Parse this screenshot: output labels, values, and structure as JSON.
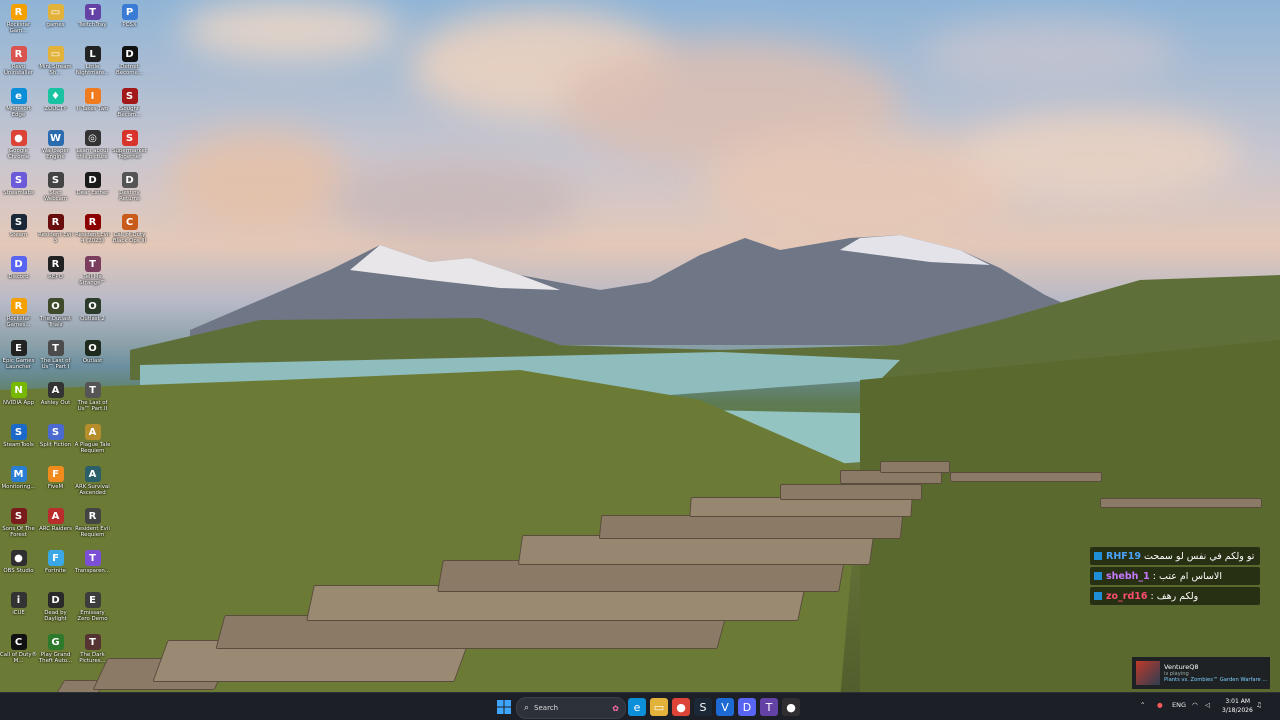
{
  "desktop_icons": [
    {
      "label": "Rockstar Gam...",
      "color": "#f4a000",
      "glyph": "R"
    },
    {
      "label": "games",
      "color": "#e2b23b",
      "glyph": "▭"
    },
    {
      "label": "TwitchTray",
      "color": "#6441a5",
      "glyph": "T"
    },
    {
      "label": "PCSX",
      "color": "#3a7bd5",
      "glyph": "P"
    },
    {
      "label": "Revo Uninstaller",
      "color": "#d9534f",
      "glyph": "R"
    },
    {
      "label": "Mini Stream Sh...",
      "color": "#e2b23b",
      "glyph": "▭"
    },
    {
      "label": "Little Nightmare...",
      "color": "#222",
      "glyph": "L"
    },
    {
      "label": "Detroit Become...",
      "color": "#111",
      "glyph": "D"
    },
    {
      "label": "Microsoft Edge",
      "color": "#0c8ed9",
      "glyph": "e"
    },
    {
      "label": "ZOUCTY",
      "color": "#19c3a1",
      "glyph": "♦"
    },
    {
      "label": "Il Takes Two",
      "color": "#f07b1e",
      "glyph": "I"
    },
    {
      "label": "Sought Becom...",
      "color": "#a31919",
      "glyph": "S"
    },
    {
      "label": "Google Chrome",
      "color": "#db4437",
      "glyph": "●"
    },
    {
      "label": "Wallpaper Engine",
      "color": "#2b6cb0",
      "glyph": "W"
    },
    {
      "label": "Learn about this picture",
      "color": "#333",
      "glyph": "◎"
    },
    {
      "label": "Supermarket Together",
      "color": "#d8342b",
      "glyph": "S"
    },
    {
      "label": "Streamlabs",
      "color": "#6b5bd9",
      "glyph": "S"
    },
    {
      "label": "Stan Webcam",
      "color": "#444",
      "glyph": "S"
    },
    {
      "label": "Dear Esther",
      "color": "#1a1a1a",
      "glyph": "D"
    },
    {
      "label": "Destiny Returns",
      "color": "#555",
      "glyph": "D"
    },
    {
      "label": "Steam",
      "color": "#1b2838",
      "glyph": "S"
    },
    {
      "label": "Resident Evil 3",
      "color": "#6a0d0d",
      "glyph": "R"
    },
    {
      "label": "Resident Evil 4 (2023)",
      "color": "#8b0000",
      "glyph": "R"
    },
    {
      "label": "Call of Duty Black Ops III",
      "color": "#c85a1a",
      "glyph": "C"
    },
    {
      "label": "Discord",
      "color": "#5865f2",
      "glyph": "D"
    },
    {
      "label": "REPO",
      "color": "#222",
      "glyph": "R"
    },
    {
      "label": "Tell Me Strange™",
      "color": "#7a3d5e",
      "glyph": "T"
    },
    {
      "label": "",
      "color": "transparent",
      "glyph": ""
    },
    {
      "label": "Rockstar Games...",
      "color": "#f4a000",
      "glyph": "R"
    },
    {
      "label": "The Outlast Trials",
      "color": "#3f4a2a",
      "glyph": "O"
    },
    {
      "label": "Outlast 2",
      "color": "#2b3d2a",
      "glyph": "O"
    },
    {
      "label": "",
      "color": "transparent",
      "glyph": ""
    },
    {
      "label": "Epic Games Launcher",
      "color": "#222",
      "glyph": "E"
    },
    {
      "label": "The Last of Us™ Part I",
      "color": "#4c4c4c",
      "glyph": "T"
    },
    {
      "label": "Outlast",
      "color": "#1f2a1f",
      "glyph": "O"
    },
    {
      "label": "",
      "color": "transparent",
      "glyph": ""
    },
    {
      "label": "NVIDIA App",
      "color": "#76b900",
      "glyph": "N"
    },
    {
      "label": "Ashley Out",
      "color": "#333",
      "glyph": "A"
    },
    {
      "label": "The Last of Us™ Part II",
      "color": "#555",
      "glyph": "T"
    },
    {
      "label": "",
      "color": "transparent",
      "glyph": ""
    },
    {
      "label": "SteamTools",
      "color": "#1b6ac9",
      "glyph": "S"
    },
    {
      "label": "Split Fiction",
      "color": "#4a6ad0",
      "glyph": "S"
    },
    {
      "label": "A Plague Tale Requiem",
      "color": "#b58d2b",
      "glyph": "A"
    },
    {
      "label": "",
      "color": "transparent",
      "glyph": ""
    },
    {
      "label": "Monitoring...",
      "color": "#2a7fd4",
      "glyph": "M"
    },
    {
      "label": "FiveM",
      "color": "#f28b1d",
      "glyph": "F"
    },
    {
      "label": "ARK Survival Ascended",
      "color": "#2b5f6a",
      "glyph": "A"
    },
    {
      "label": "",
      "color": "transparent",
      "glyph": ""
    },
    {
      "label": "Sons Of The Forest",
      "color": "#7a1c1c",
      "glyph": "S"
    },
    {
      "label": "ARC Raiders",
      "color": "#b92d2d",
      "glyph": "A"
    },
    {
      "label": "Resident Evil Requiem",
      "color": "#444",
      "glyph": "R"
    },
    {
      "label": "",
      "color": "transparent",
      "glyph": ""
    },
    {
      "label": "OBS Studio",
      "color": "#302e31",
      "glyph": "●"
    },
    {
      "label": "Fortnite",
      "color": "#3aa7e6",
      "glyph": "F"
    },
    {
      "label": "Transparen...",
      "color": "#7b4fd6",
      "glyph": "T"
    },
    {
      "label": "",
      "color": "transparent",
      "glyph": ""
    },
    {
      "label": "iCUE",
      "color": "#333",
      "glyph": "i"
    },
    {
      "label": "Dead by Daylight",
      "color": "#2a2a2a",
      "glyph": "D"
    },
    {
      "label": "Emissary Zero Demo",
      "color": "#3d3d3d",
      "glyph": "E"
    },
    {
      "label": "",
      "color": "transparent",
      "glyph": ""
    },
    {
      "label": "Call of Duty® M...",
      "color": "#111",
      "glyph": "C"
    },
    {
      "label": "Play Grand Theft Auto...",
      "color": "#2d7a2d",
      "glyph": "G"
    },
    {
      "label": "The Dark Pictures...",
      "color": "#553333",
      "glyph": "T"
    }
  ],
  "chat": [
    {
      "user": "RHF19",
      "user_color": "#4aa3ff",
      "message": "تو تو ولكم في نفس لو سمحت :"
    },
    {
      "user": "shebh_1",
      "user_color": "#c779ff",
      "message": ": الاساس ام عتب"
    },
    {
      "user": "zo_rd16",
      "user_color": "#ff4d6d",
      "message": ": ولكم رهف"
    }
  ],
  "toast": {
    "name": "VentureQ8",
    "status": "is playing",
    "game": "Plants vs. Zombies™ Garden Warfare ..."
  },
  "taskbar": {
    "search_label": "Search",
    "apps": [
      {
        "name": "edge-taskbar-icon",
        "glyph": "e",
        "color": "#0c8ed9"
      },
      {
        "name": "file-explorer-taskbar-icon",
        "glyph": "▭",
        "color": "#e2b23b"
      },
      {
        "name": "chrome-taskbar-icon",
        "glyph": "●",
        "color": "#db4437"
      },
      {
        "name": "steam-taskbar-icon",
        "glyph": "S",
        "color": "#1b2838"
      },
      {
        "name": "vpn-taskbar-icon",
        "glyph": "V",
        "color": "#1e6ad3"
      },
      {
        "name": "discord-taskbar-icon",
        "glyph": "D",
        "color": "#5865f2"
      },
      {
        "name": "twitch-taskbar-icon",
        "glyph": "T",
        "color": "#6441a5"
      },
      {
        "name": "obs-taskbar-icon",
        "glyph": "●",
        "color": "#302e31"
      }
    ],
    "lang": "ENG",
    "time": "3:01 AM",
    "date": "3/18/2026"
  }
}
